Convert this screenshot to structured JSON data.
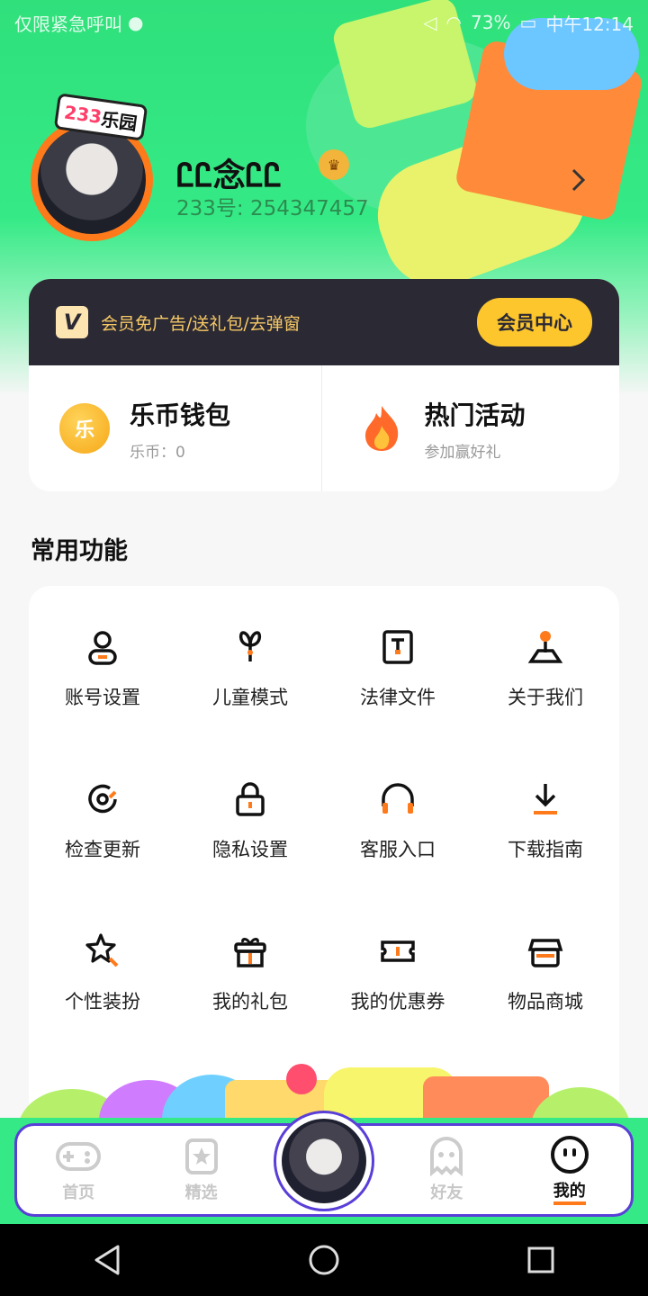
{
  "status_bar": {
    "left_text": "仅限紧急呼叫",
    "battery": "73%",
    "time": "中午12:14"
  },
  "profile": {
    "badge_num": "233",
    "badge_text": "乐园",
    "username": "ᏝᏝ念ᏝᏝ",
    "uid": "233号: 254347457"
  },
  "vip": {
    "logo": "V",
    "promo": "会员免广告/送礼包/去弹窗",
    "button": "会员中心"
  },
  "wallet": {
    "coin_symbol": "乐",
    "title": "乐币钱包",
    "sub": "乐币：0"
  },
  "activity": {
    "title": "热门活动",
    "sub": "参加赢好礼"
  },
  "section_title": "常用功能",
  "functions": [
    {
      "label": "账号设置",
      "icon": "user-icon"
    },
    {
      "label": "儿童模式",
      "icon": "sprout-icon"
    },
    {
      "label": "法律文件",
      "icon": "document-icon"
    },
    {
      "label": "关于我们",
      "icon": "joystick-icon"
    },
    {
      "label": "检查更新",
      "icon": "refresh-icon"
    },
    {
      "label": "隐私设置",
      "icon": "lock-icon"
    },
    {
      "label": "客服入口",
      "icon": "headphones-icon"
    },
    {
      "label": "下载指南",
      "icon": "download-icon"
    },
    {
      "label": "个性装扮",
      "icon": "star-wand-icon"
    },
    {
      "label": "我的礼包",
      "icon": "gift-icon"
    },
    {
      "label": "我的优惠券",
      "icon": "ticket-icon"
    },
    {
      "label": "物品商城",
      "icon": "shop-icon"
    }
  ],
  "nav": {
    "home": "首页",
    "featured": "精选",
    "friends": "好友",
    "mine": "我的"
  },
  "colors": {
    "accent": "#ff7a1a",
    "hero_green": "#35ea86",
    "vip_dark": "#2b2934",
    "vip_gold": "#fcc62c"
  }
}
